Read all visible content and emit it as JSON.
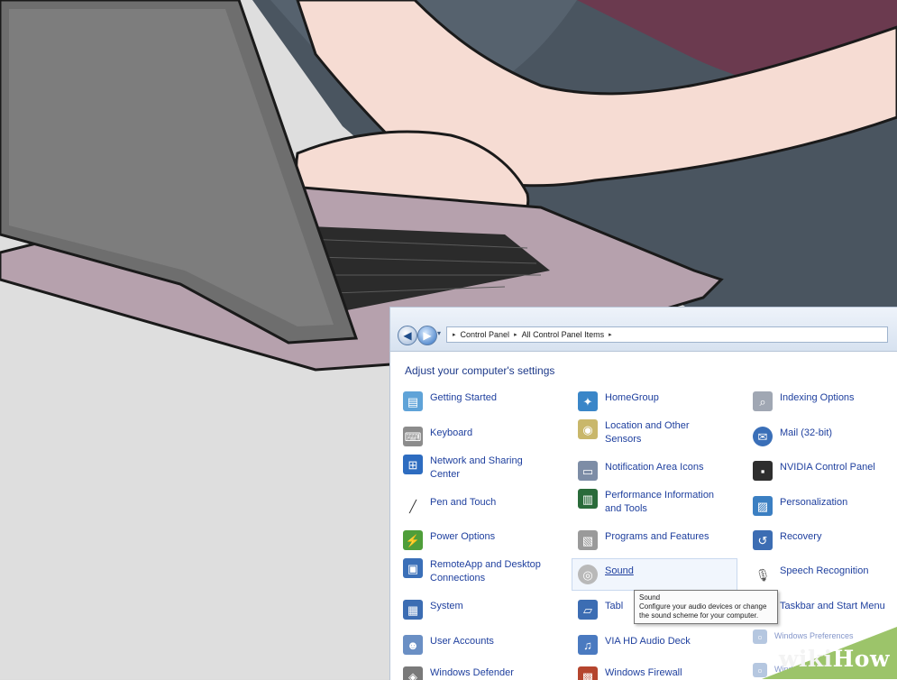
{
  "address_bar": {
    "crumbs": [
      "Control Panel",
      "All Control Panel Items"
    ],
    "separator": "▸"
  },
  "page_title": "Adjust your computer's settings",
  "items": {
    "col1": [
      "Getting Started",
      "Keyboard",
      "Network and Sharing Center",
      "Pen and Touch",
      "Power Options",
      "RemoteApp and Desktop Connections",
      "System",
      "User Accounts",
      "Windows Defender"
    ],
    "col2": [
      "HomeGroup",
      "Location and Other Sensors",
      "Notification Area Icons",
      "Performance Information and Tools",
      "Programs and Features",
      "Sound",
      "Tabl",
      "VIA HD Audio Deck",
      "Windows Firewall"
    ],
    "col3": [
      "Indexing Options",
      "Mail (32-bit)",
      "NVIDIA Control Panel",
      "Personalization",
      "Recovery",
      "Speech Recognition",
      "Taskbar and Start Menu",
      "Windows Preferences",
      "Windows Update"
    ]
  },
  "tooltip": {
    "title": "Sound",
    "body": "Configure your audio devices or change the sound scheme for your computer."
  },
  "watermark": {
    "part1": "wiki",
    "part2": "How"
  },
  "colors": {
    "link": "#1e3f9e",
    "watermark_green": "#9cc46a"
  }
}
